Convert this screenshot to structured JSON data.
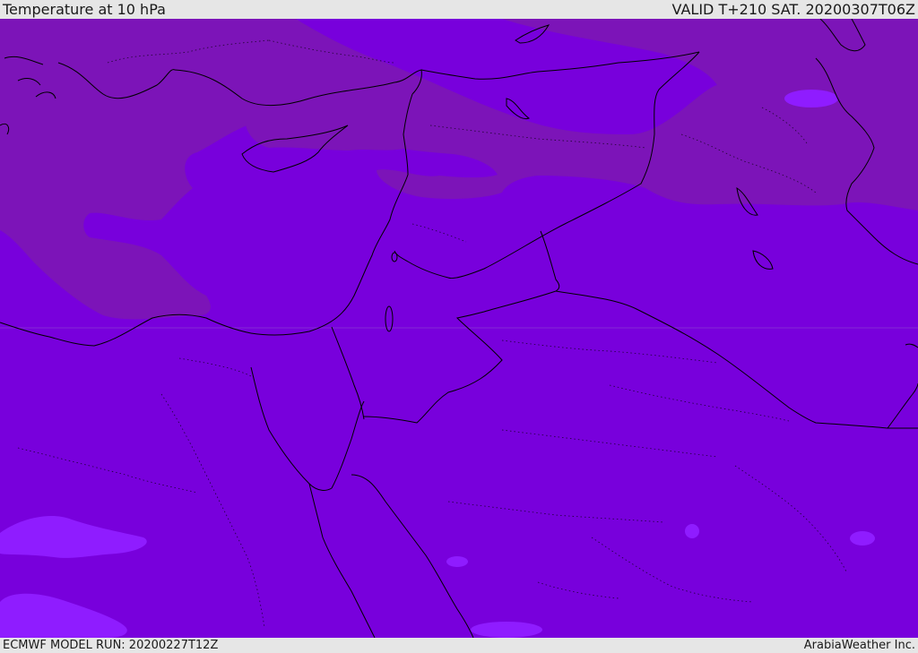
{
  "header": {
    "title": "Temperature at 10 hPa",
    "valid": "VALID T+210 SAT. 20200307T06Z"
  },
  "footer": {
    "model_run": "ECMWF MODEL RUN: 20200227T12Z",
    "credit": "ArabiaWeather Inc."
  },
  "map": {
    "field_colors": {
      "base": "#7800dc",
      "warm_band": "#7c14b8",
      "cool_pockets": "#8f1cff"
    },
    "line_color": "#000000"
  }
}
